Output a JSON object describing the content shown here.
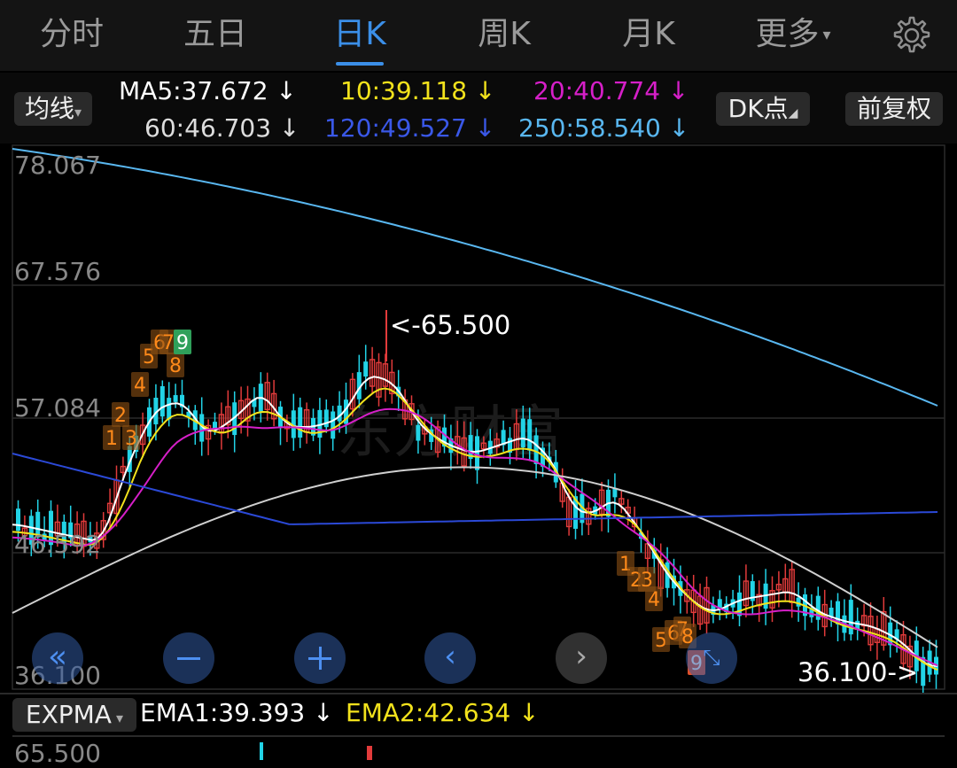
{
  "tabs": [
    {
      "label": "分时",
      "active": false
    },
    {
      "label": "五日",
      "active": false
    },
    {
      "label": "日K",
      "active": true
    },
    {
      "label": "周K",
      "active": false
    },
    {
      "label": "月K",
      "active": false
    },
    {
      "label": "更多",
      "active": false
    }
  ],
  "ma_bar": {
    "toggle_label": "均线",
    "ma5": "MA5:37.672 ↓",
    "ma10": "10:39.118 ↓",
    "ma20": "20:40.774 ↓",
    "ma60": "60:46.703 ↓",
    "ma120": "120:49.527 ↓",
    "ma250": "250:58.540 ↓",
    "dk_button": "DK点",
    "fq_button": "前复权"
  },
  "chart": {
    "y_labels": [
      "78.067",
      "67.576",
      "57.084",
      "46.592",
      "36.100"
    ],
    "high_annotation": "<-65.500",
    "low_annotation": "36.100->",
    "watermark": "东方财富",
    "colors": {
      "up": "#e23b3b",
      "down": "#22d3e6",
      "ma5": "#ffffff",
      "ma10": "#f2e21c",
      "ma20": "#d61fc8",
      "ma60": "#cfcfcf",
      "ma120": "#2b49d6",
      "ma250": "#59b7f0"
    }
  },
  "seq_markers": {
    "group1": [
      "1",
      "2",
      "3",
      "4",
      "5",
      "6",
      "7",
      "8",
      "9"
    ],
    "group2": [
      "1",
      "2",
      "3",
      "4",
      "5",
      "6",
      "7",
      "8",
      "9"
    ]
  },
  "nav": {
    "icons": [
      "double-left-icon",
      "minus-icon",
      "plus-icon",
      "left-icon",
      "right-icon",
      "fullscreen-icon"
    ]
  },
  "indicator": {
    "select_label": "EXPMA",
    "ema1": "EMA1:39.393 ↓",
    "ema2": "EMA2:42.634 ↓",
    "top_value": "65.500"
  }
}
